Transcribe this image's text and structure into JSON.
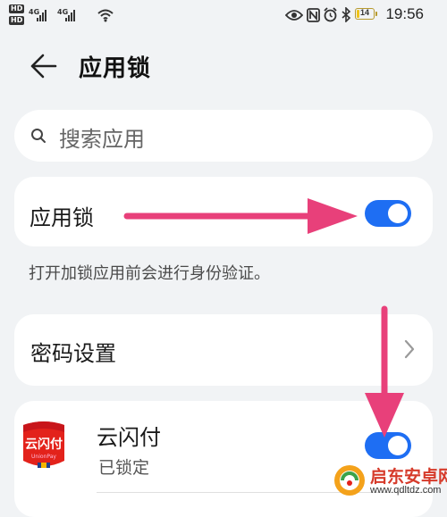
{
  "status_bar": {
    "time": "19:56",
    "battery": "14",
    "hd1": "HD",
    "hd2": "HD",
    "net1": "4G",
    "net2": "4G",
    "icons": [
      "eye-icon",
      "nfc-icon",
      "alarm-icon",
      "bluetooth-icon",
      "wifi-icon"
    ]
  },
  "header": {
    "title": "应用锁",
    "back_icon": "back-arrow-icon"
  },
  "search": {
    "placeholder": "搜索应用"
  },
  "app_lock_row": {
    "label": "应用锁",
    "enabled": true
  },
  "app_lock_description": "打开加锁应用前会进行身份验证。",
  "password_row": {
    "label": "密码设置"
  },
  "apps": [
    {
      "name": "云闪付",
      "status": "已锁定",
      "icon_text": "云闪付",
      "icon_sub": "UnionPay",
      "locked": true
    }
  ],
  "watermark": {
    "text": "启东安卓网",
    "url": "www.qdltdz.com"
  },
  "colors": {
    "accent": "#1e6ef3",
    "arrow": "#e8407a",
    "background": "#f1f3f5"
  }
}
